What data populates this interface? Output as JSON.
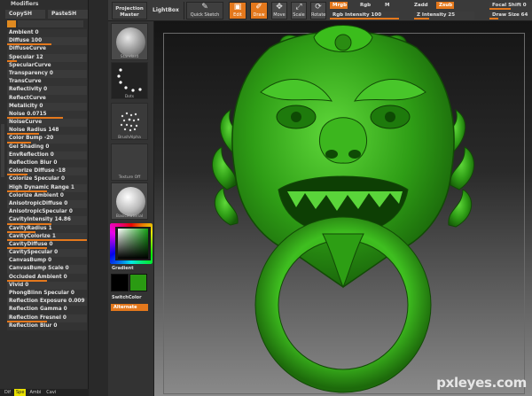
{
  "modifiers": {
    "title": "Modifiers",
    "copy_label": "CopySH",
    "paste_label": "PasteSH",
    "rows": [
      {
        "label": "Ambient 0",
        "fill": 0.0
      },
      {
        "label": "Diffuse 100",
        "fill": 0.55
      },
      {
        "label": "DiffuseCurve",
        "fill": null
      },
      {
        "label": "Specular 12",
        "fill": 0.12
      },
      {
        "label": "SpecularCurve",
        "fill": null
      },
      {
        "label": "Transparency 0",
        "fill": 0.0
      },
      {
        "label": "TransCurve",
        "fill": null
      },
      {
        "label": "Reflectivity 0",
        "fill": 0.0
      },
      {
        "label": "ReflectCurve",
        "fill": null
      },
      {
        "label": "Metalicity 0",
        "fill": 0.0
      },
      {
        "label": "Noise 0.0715",
        "fill": 0.7
      },
      {
        "label": "NoiseCurve",
        "fill": null
      },
      {
        "label": "Noise Radius 148",
        "fill": 0.4
      },
      {
        "label": "Color Bump -20",
        "fill": 0.3
      },
      {
        "label": "Gel Shading 0",
        "fill": 0.0
      },
      {
        "label": "EnvReflection 0",
        "fill": 0.0
      },
      {
        "label": "Reflection Blur 0",
        "fill": 0.0
      },
      {
        "label": "Colorize Diffuse -18",
        "fill": 0.25
      },
      {
        "label": "Colorize Specular 0",
        "fill": 0.0
      },
      {
        "label": "High Dynamic Range 1",
        "fill": 0.5
      },
      {
        "label": "Colorize Ambient 0",
        "fill": 0.0
      },
      {
        "label": "AnisotropicDiffuse 0",
        "fill": 0.0
      },
      {
        "label": "AnisotropicSpecular 0",
        "fill": 0.0
      },
      {
        "label": "CavityIntensity 14.86",
        "fill": 0.55
      },
      {
        "label": "CavityRadius 1",
        "fill": 0.35
      },
      {
        "label": "CavityColorize 1",
        "fill": 1.0
      },
      {
        "label": "CavityDiffuse 0",
        "fill": 0.5
      },
      {
        "label": "CavitySpecular 0",
        "fill": 0.0
      },
      {
        "label": "CanvasBump 0",
        "fill": 0.0
      },
      {
        "label": "CanvasBump Scale 0",
        "fill": 0.0
      },
      {
        "label": "Occluded Ambient 0",
        "fill": 0.5
      },
      {
        "label": "Vivid 0",
        "fill": 0.0
      },
      {
        "label": "PhongBlinn Specular 0",
        "fill": 0.0
      },
      {
        "label": "Reflection Exposure 0.009",
        "fill": 0.0
      },
      {
        "label": "Reflection Gamma 0",
        "fill": 0.0
      },
      {
        "label": "Reflection Fresnel 0",
        "fill": 0.5
      },
      {
        "label": "Reflection Blur 0",
        "fill": 0.0
      }
    ],
    "bottom_tabs": [
      "Dif",
      "Spe",
      "Ambi",
      "Cavi"
    ]
  },
  "toolbar": {
    "projection_master": "Projection Master",
    "lightbox": "LightBox",
    "quick_sketch": "Quick Sketch",
    "edit": "Edit",
    "draw": "Draw",
    "move": "Move",
    "scale": "Scale",
    "rotate": "Rotate",
    "mrgb": "Mrgb",
    "rgb": "Rgb",
    "m": "M",
    "zadd": "Zadd",
    "zsub": "Zsub",
    "rgb_intensity": "Rgb Intensity 100",
    "z_intensity": "Z Intensity 25",
    "focal_shift": "Focal Shift 0",
    "draw_size": "Draw Size 64"
  },
  "palette": {
    "materials": [
      "Standard",
      "Dots",
      "BrushAlpha",
      "Texture Off",
      "BasicMaterial"
    ],
    "gradient": "Gradient",
    "switch_color": "SwitchColor",
    "alternate": "Alternate",
    "main_color": "#2a9a12",
    "secondary_color": "#000000"
  },
  "watermark": "pxleyes.com",
  "colors": {
    "accent": "#e4781c",
    "panel": "#2e2e2e",
    "jade": "#2fae14"
  }
}
